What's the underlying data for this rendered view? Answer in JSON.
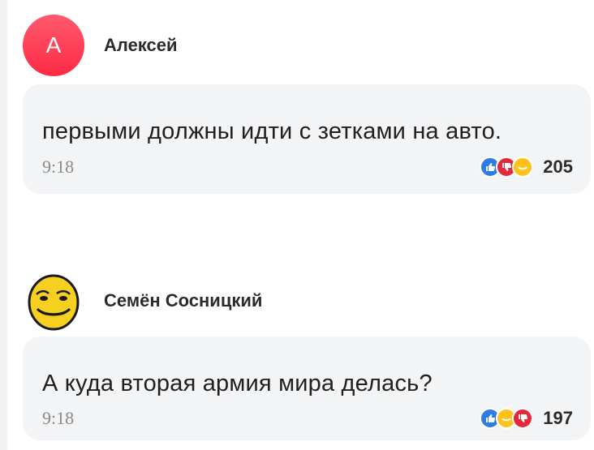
{
  "comments": [
    {
      "author": "Алексей",
      "avatar_letter": "А",
      "text": "первыми должны идти с зетками на авто.",
      "time": "9:18",
      "reactions": [
        "like-icon",
        "dislike-icon",
        "smile-icon"
      ],
      "reaction_count": "205"
    },
    {
      "author": "Семён Сосницкий",
      "avatar_letter": "",
      "text": "А куда вторая армия мира делась?",
      "time": "9:18",
      "reactions": [
        "like-icon",
        "smile-icon",
        "dislike-icon"
      ],
      "reaction_count": "197"
    }
  ],
  "colors": {
    "avatar_red": "#ff3a55",
    "bubble_bg": "#f3f4f6",
    "like_blue": "#2d7be5",
    "dislike_red": "#e5283a",
    "smile_yellow": "#ffc21a"
  }
}
